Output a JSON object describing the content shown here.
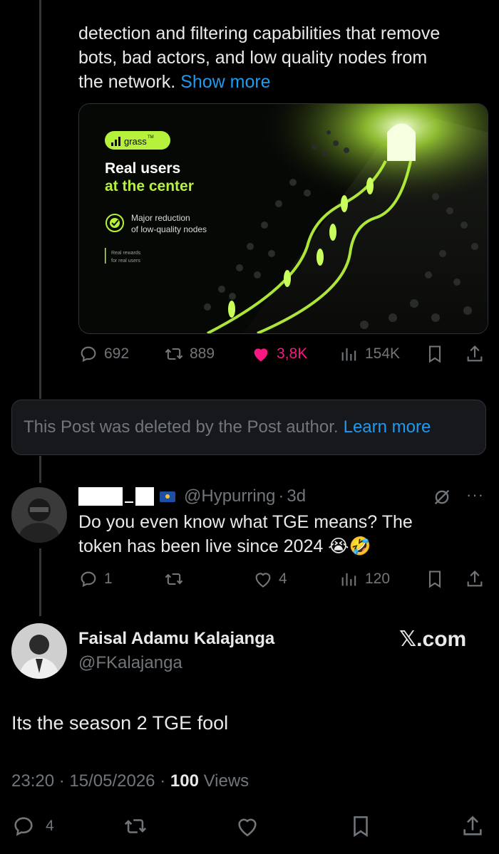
{
  "tweet": {
    "text_lines": [
      "detection and filtering capabilities that remove",
      "bots, bad actors, and low quality nodes from",
      "the network."
    ],
    "show_more": "Show more",
    "media": {
      "logo_text": "grass",
      "logo_tm": "TM",
      "headline_line1": "Real users",
      "headline_line2": "at the center",
      "feature_line1": "Major reduction",
      "feature_line2": "of low-quality nodes",
      "footnote_line1": "Real rewards",
      "footnote_line2": "for real users",
      "accent_color": "#b6f23c"
    },
    "stats": {
      "replies": "692",
      "reposts": "889",
      "likes": "3,8K",
      "views": "154K"
    }
  },
  "deleted_notice": {
    "text": "This Post was deleted by the Post author.",
    "link": "Learn more"
  },
  "reply": {
    "handle": "@Hypurring",
    "time": "3d",
    "text_line1": "Do you even know what TGE means? The",
    "text_line2": "token has been live since 2024",
    "emojis": "😭🤣",
    "stats": {
      "replies": "1",
      "reposts": "",
      "likes": "4",
      "views": "120"
    }
  },
  "main_post": {
    "name": "Faisal Adamu Kalajanga",
    "handle": "@FKalajanga",
    "watermark": "𝕏.com",
    "text": "Its the season 2 TGE fool",
    "time": "23:20",
    "date": "15/05/2026",
    "views_count": "100",
    "views_label": "Views",
    "stats": {
      "replies": "4"
    }
  },
  "colors": {
    "background": "#000000",
    "link": "#1d9bf0",
    "like": "#f91880",
    "muted": "#71767b"
  }
}
